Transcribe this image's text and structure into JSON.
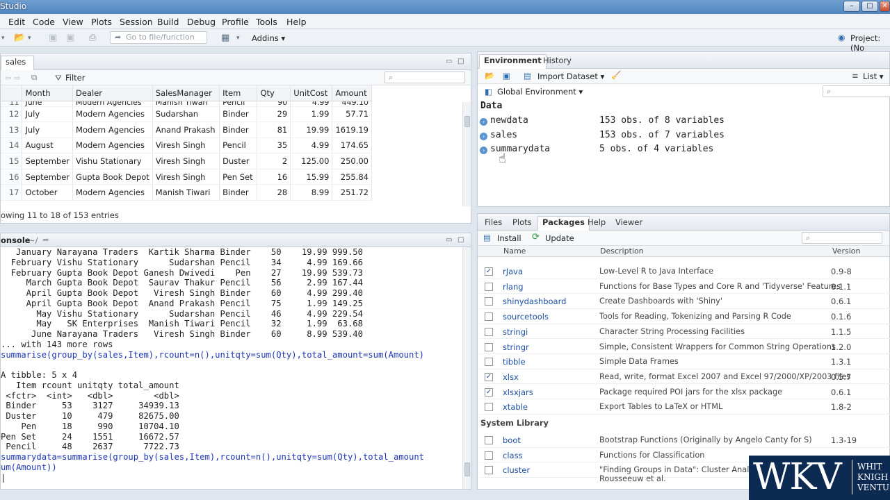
{
  "window": {
    "title": "Studio",
    "controls": [
      "–",
      "□",
      "✕"
    ]
  },
  "menu": [
    "Edit",
    "Code",
    "View",
    "Plots",
    "Session",
    "Build",
    "Debug",
    "Profile",
    "Tools",
    "Help"
  ],
  "toolbar": {
    "goto_placeholder": "Go to file/function",
    "addins": "Addins",
    "project": "Project: (No"
  },
  "viewer": {
    "tab": "sales",
    "filter": "Filter",
    "columns": [
      "Month",
      "Dealer",
      "SalesManager",
      "Item",
      "Qty",
      "UnitCost",
      "Amount"
    ],
    "partial_row": [
      "11",
      "June",
      "Modern Agencies",
      "Manish Tiwari",
      "Pencil",
      "90",
      "4.99",
      "449.10"
    ],
    "rows": [
      [
        "12",
        "July",
        "Modern Agencies",
        "Sudarshan",
        "Binder",
        "29",
        "1.99",
        "57.71"
      ],
      [
        "13",
        "July",
        "Modern Agencies",
        "Anand Prakash",
        "Binder",
        "81",
        "19.99",
        "1619.19"
      ],
      [
        "14",
        "August",
        "Modern Agencies",
        "Viresh Singh",
        "Pencil",
        "35",
        "4.99",
        "174.65"
      ],
      [
        "15",
        "September",
        "Vishu Stationary",
        "Viresh Singh",
        "Duster",
        "2",
        "125.00",
        "250.00"
      ],
      [
        "16",
        "September",
        "Gupta Book Depot",
        "Viresh Singh",
        "Pen Set",
        "16",
        "15.99",
        "255.84"
      ],
      [
        "17",
        "October",
        "Modern Agencies",
        "Manish Tiwari",
        "Binder",
        "28",
        "8.99",
        "251.72"
      ]
    ],
    "status": "owing 11 to 18 of 153 entries"
  },
  "console": {
    "title": "onsole",
    "path": "~/",
    "lines": [
      {
        "t": "   January Narayana Traders  Kartik Sharma Binder    50    19.99 999.50",
        "c": ""
      },
      {
        "t": "  February Vishu Stationary      Sudarshan Pencil    34     4.99 169.66",
        "c": ""
      },
      {
        "t": "  February Gupta Book Depot Ganesh Dwivedi    Pen    27    19.99 539.73",
        "c": ""
      },
      {
        "t": "     March Gupta Book Depot  Saurav Thakur Pencil    56     2.99 167.44",
        "c": ""
      },
      {
        "t": "     April Gupta Book Depot   Viresh Singh Binder    60     4.99 299.40",
        "c": ""
      },
      {
        "t": "     April Gupta Book Depot  Anand Prakash Pencil    75     1.99 149.25",
        "c": ""
      },
      {
        "t": "       May Vishu Stationary      Sudarshan Pencil    46     4.99 229.54",
        "c": ""
      },
      {
        "t": "       May   SK Enterprises  Manish Tiwari Pencil    32     1.99  63.68",
        "c": ""
      },
      {
        "t": "      June Narayana Traders   Viresh Singh Binder    60     8.99 539.40",
        "c": ""
      },
      {
        "t": "... with 143 more rows",
        "c": ""
      },
      {
        "t": "summarise(group_by(sales,Item),rcount=n(),unitqty=sum(Qty),total_amount=sum(Amount)",
        "c": "cmd"
      },
      {
        "t": "",
        "c": ""
      },
      {
        "t": "A tibble: 5 x 4",
        "c": ""
      },
      {
        "t": "   Item rcount unitqty total_amount",
        "c": ""
      },
      {
        "t": " <fctr>  <int>   <dbl>        <dbl>",
        "c": ""
      },
      {
        "t": " Binder     53    3127     34939.13",
        "c": ""
      },
      {
        "t": " Duster     10     479     82675.00",
        "c": ""
      },
      {
        "t": "    Pen     18     990     10704.10",
        "c": ""
      },
      {
        "t": "Pen Set     24    1551     16672.57",
        "c": ""
      },
      {
        "t": " Pencil     48    2637      7722.73",
        "c": ""
      },
      {
        "t": "summarydata=summarise(group_by(sales,Item),rcount=n(),unitqty=sum(Qty),total_amount",
        "c": "cmd"
      },
      {
        "t": "um(Amount))",
        "c": "cmd"
      },
      {
        "t": "|",
        "c": ""
      }
    ]
  },
  "environment": {
    "tabs": [
      "Environment",
      "History"
    ],
    "import": "Import Dataset",
    "list": "List",
    "scope": "Global Environment",
    "section": "Data",
    "items": [
      {
        "name": "newdata",
        "desc": "153 obs. of 8 variables"
      },
      {
        "name": "sales",
        "desc": "153 obs. of 7 variables"
      },
      {
        "name": "summarydata",
        "desc": "5 obs. of 4 variables"
      }
    ]
  },
  "packages": {
    "tabs": [
      "Files",
      "Plots",
      "Packages",
      "Help",
      "Viewer"
    ],
    "install": "Install",
    "update": "Update",
    "columns": [
      "Name",
      "Description",
      "Version"
    ],
    "rows": [
      {
        "checked": true,
        "name": "rJava",
        "desc": "Low-Level R to Java Interface",
        "ver": "0.9-8"
      },
      {
        "checked": false,
        "name": "rlang",
        "desc": "Functions for Base Types and Core R and 'Tidyverse' Features",
        "ver": "0.1.1"
      },
      {
        "checked": false,
        "name": "shinydashboard",
        "desc": "Create Dashboards with 'Shiny'",
        "ver": "0.6.1"
      },
      {
        "checked": false,
        "name": "sourcetools",
        "desc": "Tools for Reading, Tokenizing and Parsing R Code",
        "ver": "0.1.6"
      },
      {
        "checked": false,
        "name": "stringi",
        "desc": "Character String Processing Facilities",
        "ver": "1.1.5"
      },
      {
        "checked": false,
        "name": "stringr",
        "desc": "Simple, Consistent Wrappers for Common String Operations",
        "ver": "1.2.0"
      },
      {
        "checked": false,
        "name": "tibble",
        "desc": "Simple Data Frames",
        "ver": "1.3.1"
      },
      {
        "checked": true,
        "name": "xlsx",
        "desc": "Read, write, format Excel 2007 and Excel 97/2000/XP/2003 files",
        "ver": "0.5.7"
      },
      {
        "checked": true,
        "name": "xlsxjars",
        "desc": "Package required POI jars for the xlsx package",
        "ver": "0.6.1"
      },
      {
        "checked": false,
        "name": "xtable",
        "desc": "Export Tables to LaTeX or HTML",
        "ver": "1.8-2"
      }
    ],
    "system_section": "System Library",
    "system_rows": [
      {
        "checked": false,
        "name": "boot",
        "desc": "Bootstrap Functions (Originally by Angelo Canty for S)",
        "ver": "1.3-19"
      },
      {
        "checked": false,
        "name": "class",
        "desc": "Functions for Classification",
        "ver": ""
      },
      {
        "checked": false,
        "name": "cluster",
        "desc": "\"Finding Groups in Data\": Cluster Analysis",
        "desc2": "Rousseeuw et al.",
        "ver": ""
      }
    ]
  },
  "logo": {
    "text": "WKV",
    "side": [
      "WHIT",
      "KNIGH",
      "VENTU"
    ]
  }
}
